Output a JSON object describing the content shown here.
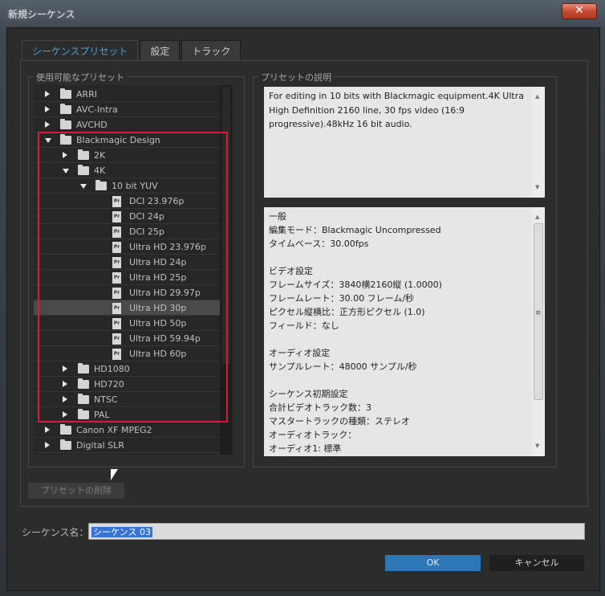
{
  "window": {
    "title": "新規シーケンス",
    "close_label": "✕"
  },
  "tabs": [
    {
      "label": "シーケンスプリセット",
      "active": true
    },
    {
      "label": "設定",
      "active": false
    },
    {
      "label": "トラック",
      "active": false
    }
  ],
  "presets": {
    "group_label": "使用可能なプリセット",
    "tree": [
      {
        "label": "ARRI",
        "kind": "folder",
        "expanded": false,
        "depth": 0
      },
      {
        "label": "AVC-Intra",
        "kind": "folder",
        "expanded": false,
        "depth": 0
      },
      {
        "label": "AVCHD",
        "kind": "folder",
        "expanded": false,
        "depth": 0
      },
      {
        "label": "Blackmagic Design",
        "kind": "folder",
        "expanded": true,
        "depth": 0
      },
      {
        "label": "2K",
        "kind": "folder",
        "expanded": false,
        "depth": 1
      },
      {
        "label": "4K",
        "kind": "folder",
        "expanded": true,
        "depth": 1
      },
      {
        "label": "10 bit YUV",
        "kind": "folder",
        "expanded": true,
        "depth": 2
      },
      {
        "label": "DCI 23.976p",
        "kind": "preset",
        "depth": 3
      },
      {
        "label": "DCI 24p",
        "kind": "preset",
        "depth": 3
      },
      {
        "label": "DCI 25p",
        "kind": "preset",
        "depth": 3
      },
      {
        "label": "Ultra HD 23.976p",
        "kind": "preset",
        "depth": 3
      },
      {
        "label": "Ultra HD 24p",
        "kind": "preset",
        "depth": 3
      },
      {
        "label": "Ultra HD 25p",
        "kind": "preset",
        "depth": 3
      },
      {
        "label": "Ultra HD 29.97p",
        "kind": "preset",
        "depth": 3
      },
      {
        "label": "Ultra HD 30p",
        "kind": "preset",
        "depth": 3,
        "selected": true
      },
      {
        "label": "Ultra HD 50p",
        "kind": "preset",
        "depth": 3
      },
      {
        "label": "Ultra HD 59.94p",
        "kind": "preset",
        "depth": 3
      },
      {
        "label": "Ultra HD 60p",
        "kind": "preset",
        "depth": 3
      },
      {
        "label": "HD1080",
        "kind": "folder",
        "expanded": false,
        "depth": 1
      },
      {
        "label": "HD720",
        "kind": "folder",
        "expanded": false,
        "depth": 1
      },
      {
        "label": "NTSC",
        "kind": "folder",
        "expanded": false,
        "depth": 1
      },
      {
        "label": "PAL",
        "kind": "folder",
        "expanded": false,
        "depth": 1
      },
      {
        "label": "Canon XF MPEG2",
        "kind": "folder",
        "expanded": false,
        "depth": 0
      },
      {
        "label": "Digital SLR",
        "kind": "folder",
        "expanded": false,
        "depth": 0
      }
    ],
    "preset_badge": "Pr",
    "delete_label": "プリセットの削除"
  },
  "description": {
    "group_label": "プリセットの説明",
    "text": "For editing in 10 bits with Blackmagic equipment.4K Ultra High Definition 2160 line, 30 fps video (16:9 progressive).48kHz 16 bit audio."
  },
  "summary": {
    "lines": [
      "一般",
      " 編集モード：Blackmagic Uncompressed",
      " タイムベース：30.00fps",
      "",
      "ビデオ設定",
      " フレームサイズ：3840横2160縦 (1.0000)",
      " フレームレート：30.00 フレーム/秒",
      " ピクセル縦横比：正方形ピクセル (1.0)",
      " フィールド：なし",
      "",
      "オーディオ設定",
      " サンプルレート：48000 サンプル/秒",
      "",
      "シーケンス初期設定",
      " 合計ビデオトラック数：3",
      " マスタートラックの種類：ステレオ",
      " オーディオトラック：",
      " オーディオ1: 標準"
    ]
  },
  "sequence_name": {
    "label": "シーケンス名：",
    "value": "シーケンス 03"
  },
  "buttons": {
    "ok": "OK",
    "cancel": "キャンセル"
  },
  "colors": {
    "accent_tab": "#4f9fd8",
    "highlight_box": "#e0163c",
    "ok_button": "#2d77b6"
  }
}
